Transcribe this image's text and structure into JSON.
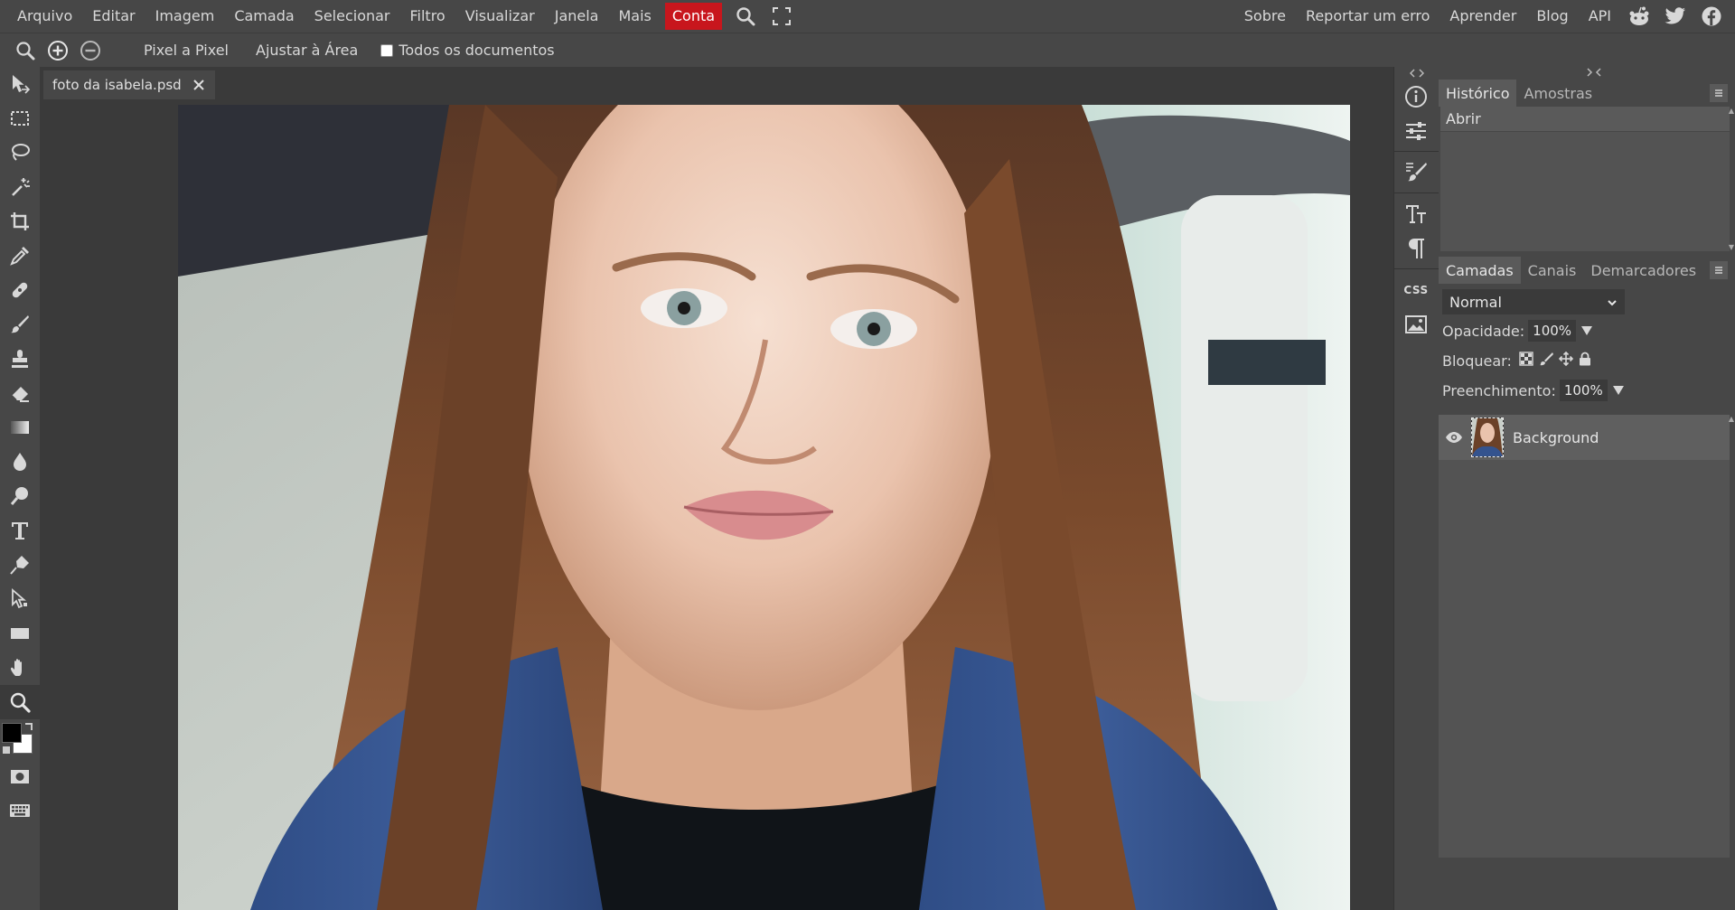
{
  "menubar": {
    "items": [
      "Arquivo",
      "Editar",
      "Imagem",
      "Camada",
      "Selecionar",
      "Filtro",
      "Visualizar",
      "Janela",
      "Mais"
    ],
    "account": "Conta",
    "right_links": [
      "Sobre",
      "Reportar um erro",
      "Aprender",
      "Blog",
      "API"
    ]
  },
  "options": {
    "pixel": "Pixel a Pixel",
    "fit": "Ajustar à Área",
    "all_docs": "Todos os documentos"
  },
  "document": {
    "tab_title": "foto da isabela.psd"
  },
  "history_panel": {
    "tabs": [
      "Histórico",
      "Amostras"
    ],
    "items": [
      "Abrir"
    ]
  },
  "layers_panel": {
    "tabs": [
      "Camadas",
      "Canais",
      "Demarcadores"
    ],
    "blend_mode": "Normal",
    "opacity_label": "Opacidade:",
    "opacity_value": "100%",
    "lock_label": "Bloquear:",
    "fill_label": "Preenchimento:",
    "fill_value": "100%",
    "layers": [
      {
        "name": "Background",
        "visible": true
      }
    ]
  },
  "iconstrip": {
    "css_label": "CSS"
  },
  "colors": {
    "accent": "#c8161d",
    "foreground": "#000000",
    "background": "#ffffff"
  }
}
